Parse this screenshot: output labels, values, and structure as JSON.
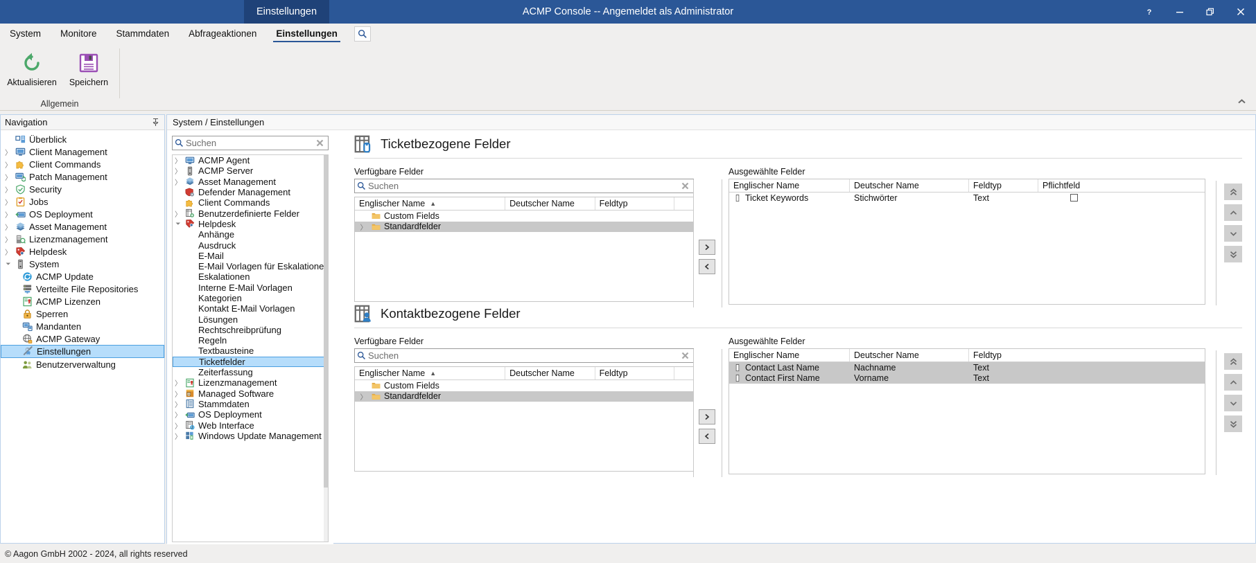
{
  "window": {
    "title": "ACMP Console -- Angemeldet als Administrator",
    "active_tab_pill": "Einstellungen",
    "help_icon": "question-mark-icon",
    "minimize_icon": "minimize-icon",
    "restore_icon": "restore-icon",
    "close_icon": "close-icon"
  },
  "ribbon": {
    "tabs": [
      {
        "label": "System",
        "active": false
      },
      {
        "label": "Monitore",
        "active": false
      },
      {
        "label": "Stammdaten",
        "active": false
      },
      {
        "label": "Abfrageaktionen",
        "active": false
      },
      {
        "label": "Einstellungen",
        "active": true
      }
    ],
    "search_icon": "search-icon",
    "collapse_icon": "chevron-up-icon",
    "group_label": "Allgemein",
    "buttons": [
      {
        "label": "Aktualisieren",
        "icon": "refresh-icon",
        "color": "#4ca86a"
      },
      {
        "label": "Speichern",
        "icon": "save-floppy-icon",
        "color": "#9b4fb5"
      }
    ]
  },
  "navigation": {
    "header": "Navigation",
    "pin_icon": "pin-icon",
    "items": [
      {
        "label": "Überblick",
        "icon": "overview-icon",
        "expandable": false,
        "level": 1,
        "selected": false
      },
      {
        "label": "Client Management",
        "icon": "monitor-icon",
        "expandable": true,
        "level": 1,
        "selected": false
      },
      {
        "label": "Client Commands",
        "icon": "puzzle-icon",
        "expandable": true,
        "level": 1,
        "selected": false
      },
      {
        "label": "Patch Management",
        "icon": "patch-icon",
        "expandable": true,
        "level": 1,
        "selected": false
      },
      {
        "label": "Security",
        "icon": "shield-icon",
        "expandable": true,
        "level": 1,
        "selected": false
      },
      {
        "label": "Jobs",
        "icon": "clipboard-icon",
        "expandable": true,
        "level": 1,
        "selected": false
      },
      {
        "label": "OS Deployment",
        "icon": "os-deploy-icon",
        "expandable": true,
        "level": 1,
        "selected": false
      },
      {
        "label": "Asset Management",
        "icon": "books-icon",
        "expandable": true,
        "level": 1,
        "selected": false
      },
      {
        "label": "Lizenzmanagement",
        "icon": "license-icon",
        "expandable": true,
        "level": 1,
        "selected": false
      },
      {
        "label": "Helpdesk",
        "icon": "helpdesk-tag-icon",
        "expandable": true,
        "level": 1,
        "selected": false
      },
      {
        "label": "System",
        "icon": "server-icon",
        "expandable": true,
        "expanded": true,
        "level": 1,
        "selected": false
      },
      {
        "label": "ACMP Update",
        "icon": "update-icon",
        "expandable": false,
        "level": 2,
        "selected": false
      },
      {
        "label": "Verteilte File Repositories",
        "icon": "repository-icon",
        "expandable": false,
        "level": 2,
        "selected": false
      },
      {
        "label": "ACMP Lizenzen",
        "icon": "certificate-icon",
        "expandable": false,
        "level": 2,
        "selected": false
      },
      {
        "label": "Sperren",
        "icon": "lock-icon",
        "expandable": false,
        "level": 2,
        "selected": false
      },
      {
        "label": "Mandanten",
        "icon": "clients-icon",
        "expandable": false,
        "level": 2,
        "selected": false
      },
      {
        "label": "ACMP Gateway",
        "icon": "gateway-globe-icon",
        "expandable": false,
        "level": 2,
        "selected": false
      },
      {
        "label": "Einstellungen",
        "icon": "tools-icon",
        "expandable": false,
        "level": 2,
        "selected": true
      },
      {
        "label": "Benutzerverwaltung",
        "icon": "users-icon",
        "expandable": false,
        "level": 2,
        "selected": false
      }
    ]
  },
  "breadcrumb": "System / Einstellungen",
  "settings_tree": {
    "search": {
      "placeholder": "Suchen",
      "value": "",
      "search_icon": "search-icon",
      "clear_icon": "clear-x-icon"
    },
    "items": [
      {
        "label": "ACMP Agent",
        "icon": "monitor-icon",
        "expandable": true,
        "level": 1,
        "selected": false
      },
      {
        "label": "ACMP Server",
        "icon": "server-icon",
        "expandable": true,
        "level": 1,
        "selected": false
      },
      {
        "label": "Asset Management",
        "icon": "books-icon",
        "expandable": true,
        "level": 1,
        "selected": false
      },
      {
        "label": "Defender Management",
        "icon": "defender-icon",
        "expandable": false,
        "level": 1,
        "selected": false
      },
      {
        "label": "Client Commands",
        "icon": "puzzle-icon",
        "expandable": false,
        "level": 1,
        "selected": false
      },
      {
        "label": "Benutzerdefinierte Felder",
        "icon": "custom-fields-icon",
        "expandable": true,
        "level": 1,
        "selected": false
      },
      {
        "label": "Helpdesk",
        "icon": "helpdesk-tag-icon",
        "expandable": true,
        "expanded": true,
        "level": 1,
        "selected": false
      },
      {
        "label": "Anhänge",
        "icon": "",
        "expandable": false,
        "level": 2,
        "selected": false
      },
      {
        "label": "Ausdruck",
        "icon": "",
        "expandable": false,
        "level": 2,
        "selected": false
      },
      {
        "label": "E-Mail",
        "icon": "",
        "expandable": false,
        "level": 2,
        "selected": false
      },
      {
        "label": "E-Mail Vorlagen für Eskalationen",
        "icon": "",
        "expandable": false,
        "level": 2,
        "selected": false
      },
      {
        "label": "Eskalationen",
        "icon": "",
        "expandable": false,
        "level": 2,
        "selected": false
      },
      {
        "label": "Interne E-Mail Vorlagen",
        "icon": "",
        "expandable": false,
        "level": 2,
        "selected": false
      },
      {
        "label": "Kategorien",
        "icon": "",
        "expandable": false,
        "level": 2,
        "selected": false
      },
      {
        "label": "Kontakt E-Mail Vorlagen",
        "icon": "",
        "expandable": false,
        "level": 2,
        "selected": false
      },
      {
        "label": "Lösungen",
        "icon": "",
        "expandable": false,
        "level": 2,
        "selected": false
      },
      {
        "label": "Rechtschreibprüfung",
        "icon": "",
        "expandable": false,
        "level": 2,
        "selected": false
      },
      {
        "label": "Regeln",
        "icon": "",
        "expandable": false,
        "level": 2,
        "selected": false
      },
      {
        "label": "Textbausteine",
        "icon": "",
        "expandable": false,
        "level": 2,
        "selected": false
      },
      {
        "label": "Ticketfelder",
        "icon": "",
        "expandable": false,
        "level": 2,
        "selected": true
      },
      {
        "label": "Zeiterfassung",
        "icon": "",
        "expandable": false,
        "level": 2,
        "selected": false
      },
      {
        "label": "Lizenzmanagement",
        "icon": "certificate-icon",
        "expandable": true,
        "level": 1,
        "selected": false
      },
      {
        "label": "Managed Software",
        "icon": "managed-software-icon",
        "expandable": true,
        "level": 1,
        "selected": false
      },
      {
        "label": "Stammdaten",
        "icon": "list-icon",
        "expandable": true,
        "level": 1,
        "selected": false
      },
      {
        "label": "OS Deployment",
        "icon": "os-deploy-icon",
        "expandable": true,
        "level": 1,
        "selected": false
      },
      {
        "label": "Web Interface",
        "icon": "web-interface-icon",
        "expandable": true,
        "level": 1,
        "selected": false
      },
      {
        "label": "Windows Update Management",
        "icon": "windows-update-icon",
        "expandable": true,
        "level": 1,
        "selected": false
      }
    ]
  },
  "sections": [
    {
      "id": "ticket",
      "title": "Ticketbezogene Felder",
      "icon": "ticket-fields-icon",
      "available": {
        "label": "Verfügbare Felder",
        "search": {
          "placeholder": "Suchen",
          "value": "",
          "search_icon": "search-icon",
          "clear_icon": "clear-x-icon"
        },
        "columns": [
          "Englischer Name",
          "Deutscher Name",
          "Feldtyp"
        ],
        "sort_column": "Englischer Name",
        "sort_direction": "asc",
        "rows": [
          {
            "cells": [
              "Custom Fields",
              "",
              ""
            ],
            "icon": "folder-icon",
            "expandable": false,
            "selected": false
          },
          {
            "cells": [
              "Standardfelder",
              "",
              ""
            ],
            "icon": "folder-icon",
            "expandable": true,
            "selected": true
          }
        ]
      },
      "selected": {
        "label": "Ausgewählte Felder",
        "columns": [
          "Englischer Name",
          "Deutscher Name",
          "Feldtyp",
          "Pflichtfeld"
        ],
        "rows": [
          {
            "cells": [
              "Ticket Keywords",
              "Stichwörter",
              "Text"
            ],
            "icon": "field-icon",
            "checkbox": false,
            "selected": false
          }
        ]
      },
      "transfer": {
        "add_label": ">",
        "remove_label": "<"
      },
      "order_buttons": [
        "move-top-icon",
        "move-up-icon",
        "move-down-icon",
        "move-bottom-icon"
      ]
    },
    {
      "id": "contact",
      "title": "Kontaktbezogene Felder",
      "icon": "contact-fields-icon",
      "available": {
        "label": "Verfügbare Felder",
        "search": {
          "placeholder": "Suchen",
          "value": "",
          "search_icon": "search-icon",
          "clear_icon": "clear-x-icon"
        },
        "columns": [
          "Englischer Name",
          "Deutscher Name",
          "Feldtyp"
        ],
        "sort_column": "Englischer Name",
        "sort_direction": "asc",
        "rows": [
          {
            "cells": [
              "Custom Fields",
              "",
              ""
            ],
            "icon": "folder-icon",
            "expandable": false,
            "selected": false
          },
          {
            "cells": [
              "Standardfelder",
              "",
              ""
            ],
            "icon": "folder-icon",
            "expandable": true,
            "selected": true
          }
        ]
      },
      "selected": {
        "label": "Ausgewählte Felder",
        "columns": [
          "Englischer Name",
          "Deutscher Name",
          "Feldtyp"
        ],
        "rows": [
          {
            "cells": [
              "Contact Last Name",
              "Nachname",
              "Text"
            ],
            "icon": "field-icon",
            "selected": true
          },
          {
            "cells": [
              "Contact First Name",
              "Vorname",
              "Text"
            ],
            "icon": "field-icon",
            "selected": true
          }
        ]
      },
      "transfer": {
        "add_label": ">",
        "remove_label": "<"
      },
      "order_buttons": [
        "move-top-icon",
        "move-up-icon",
        "move-down-icon",
        "move-bottom-icon"
      ]
    }
  ],
  "statusbar": {
    "copyright": "© Aagon GmbH 2002 - 2024, all rights reserved"
  },
  "colors": {
    "accent": "#2b5797",
    "accent_dark": "#1f4278",
    "selection": "#b6ddfb",
    "grid_selection": "#c8c8c8"
  }
}
